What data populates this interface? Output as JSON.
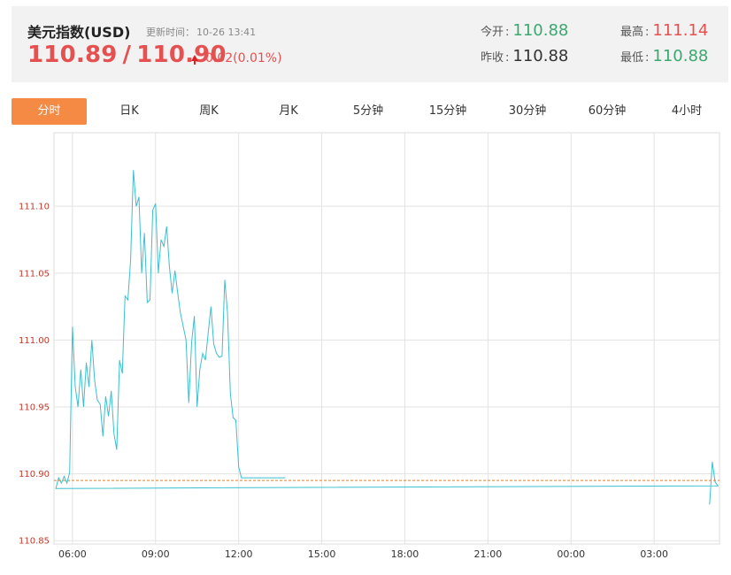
{
  "header": {
    "title": "美元指数(USD)",
    "updated_label": "更新时间：",
    "updated_time": "10-26 13:41",
    "bid": "110.89",
    "ask": "110.90",
    "change": "0.02(0.01%)",
    "arrow_icon": "up-arrow-icon",
    "open_label": "今开",
    "open_value": "110.88",
    "prev_close_label": "昨收",
    "prev_close_value": "110.88",
    "high_label": "最高",
    "high_value": "111.14",
    "low_label": "最低",
    "low_value": "110.88",
    "colors": {
      "up": "#e55050",
      "down": "#3aa870"
    }
  },
  "tabs": [
    {
      "label": "分时",
      "active": true
    },
    {
      "label": "日K",
      "active": false
    },
    {
      "label": "周K",
      "active": false
    },
    {
      "label": "月K",
      "active": false
    },
    {
      "label": "5分钟",
      "active": false
    },
    {
      "label": "15分钟",
      "active": false
    },
    {
      "label": "30分钟",
      "active": false
    },
    {
      "label": "60分钟",
      "active": false
    },
    {
      "label": "4小时",
      "active": false
    }
  ],
  "chart_data": {
    "type": "line",
    "title": "",
    "xlabel": "",
    "ylabel": "",
    "x_ticks": [
      "06:00",
      "09:00",
      "12:00",
      "15:00",
      "18:00",
      "21:00",
      "00:00",
      "03:00"
    ],
    "y_ticks": [
      110.85,
      110.9,
      110.95,
      111.0,
      111.05,
      111.1
    ],
    "ylim": [
      110.85,
      111.14
    ],
    "grid": true,
    "reference_line": {
      "value": 110.895,
      "style": "dashed",
      "color": "#e67e22"
    },
    "series": [
      {
        "color": "#3bbfcf",
        "x": [
          "05:00",
          "05:06",
          "05:12",
          "05:18",
          "05:24",
          "05:30",
          "05:36",
          "05:42",
          "05:48",
          "05:54",
          "06:00",
          "06:06",
          "06:12",
          "06:18",
          "06:24",
          "06:30",
          "06:36",
          "06:42",
          "06:48",
          "06:54",
          "07:00",
          "07:06",
          "07:12",
          "07:18",
          "07:24",
          "07:30",
          "07:36",
          "07:42",
          "07:48",
          "07:54",
          "08:00",
          "08:06",
          "08:12",
          "08:18",
          "08:24",
          "08:30",
          "08:36",
          "08:42",
          "08:48",
          "08:54",
          "09:00",
          "09:06",
          "09:12",
          "09:18",
          "09:24",
          "09:30",
          "09:36",
          "09:42",
          "09:48",
          "09:54",
          "10:00",
          "10:06",
          "10:12",
          "10:18",
          "10:24",
          "10:30",
          "10:36",
          "10:42",
          "10:48",
          "10:54",
          "11:00",
          "11:06",
          "11:12",
          "11:18",
          "11:24",
          "11:30",
          "11:36",
          "11:42",
          "11:48",
          "11:54",
          "12:00",
          "12:06",
          "12:12",
          "12:18",
          "12:24",
          "12:30",
          "12:36",
          "12:42",
          "12:48",
          "12:54",
          "13:00",
          "13:06",
          "13:12",
          "13:18",
          "13:24",
          "13:30",
          "13:36",
          "13:41"
        ],
        "y": [
          110.877,
          110.909,
          110.894,
          110.891,
          110.889,
          110.897,
          110.893,
          110.898,
          110.893,
          110.901,
          111.01,
          110.965,
          110.95,
          110.978,
          110.95,
          110.983,
          110.965,
          111.0,
          110.97,
          110.955,
          110.952,
          110.928,
          110.958,
          110.943,
          110.962,
          110.93,
          110.918,
          110.985,
          110.975,
          111.033,
          111.03,
          111.06,
          111.127,
          111.1,
          111.107,
          111.05,
          111.08,
          111.028,
          111.03,
          111.097,
          111.102,
          111.05,
          111.075,
          111.07,
          111.085,
          111.055,
          111.035,
          111.052,
          111.035,
          111.02,
          111.01,
          111.0,
          110.953,
          110.998,
          111.018,
          110.95,
          110.978,
          110.99,
          110.985,
          111.005,
          111.025,
          110.997,
          110.99,
          110.987,
          110.988,
          111.045,
          111.02,
          110.96,
          110.942,
          110.94,
          110.905,
          110.897,
          110.897,
          110.897,
          110.897,
          110.897,
          110.897,
          110.897,
          110.897,
          110.897,
          110.897,
          110.897,
          110.897,
          110.897,
          110.897,
          110.897,
          110.897,
          110.897
        ]
      }
    ]
  }
}
